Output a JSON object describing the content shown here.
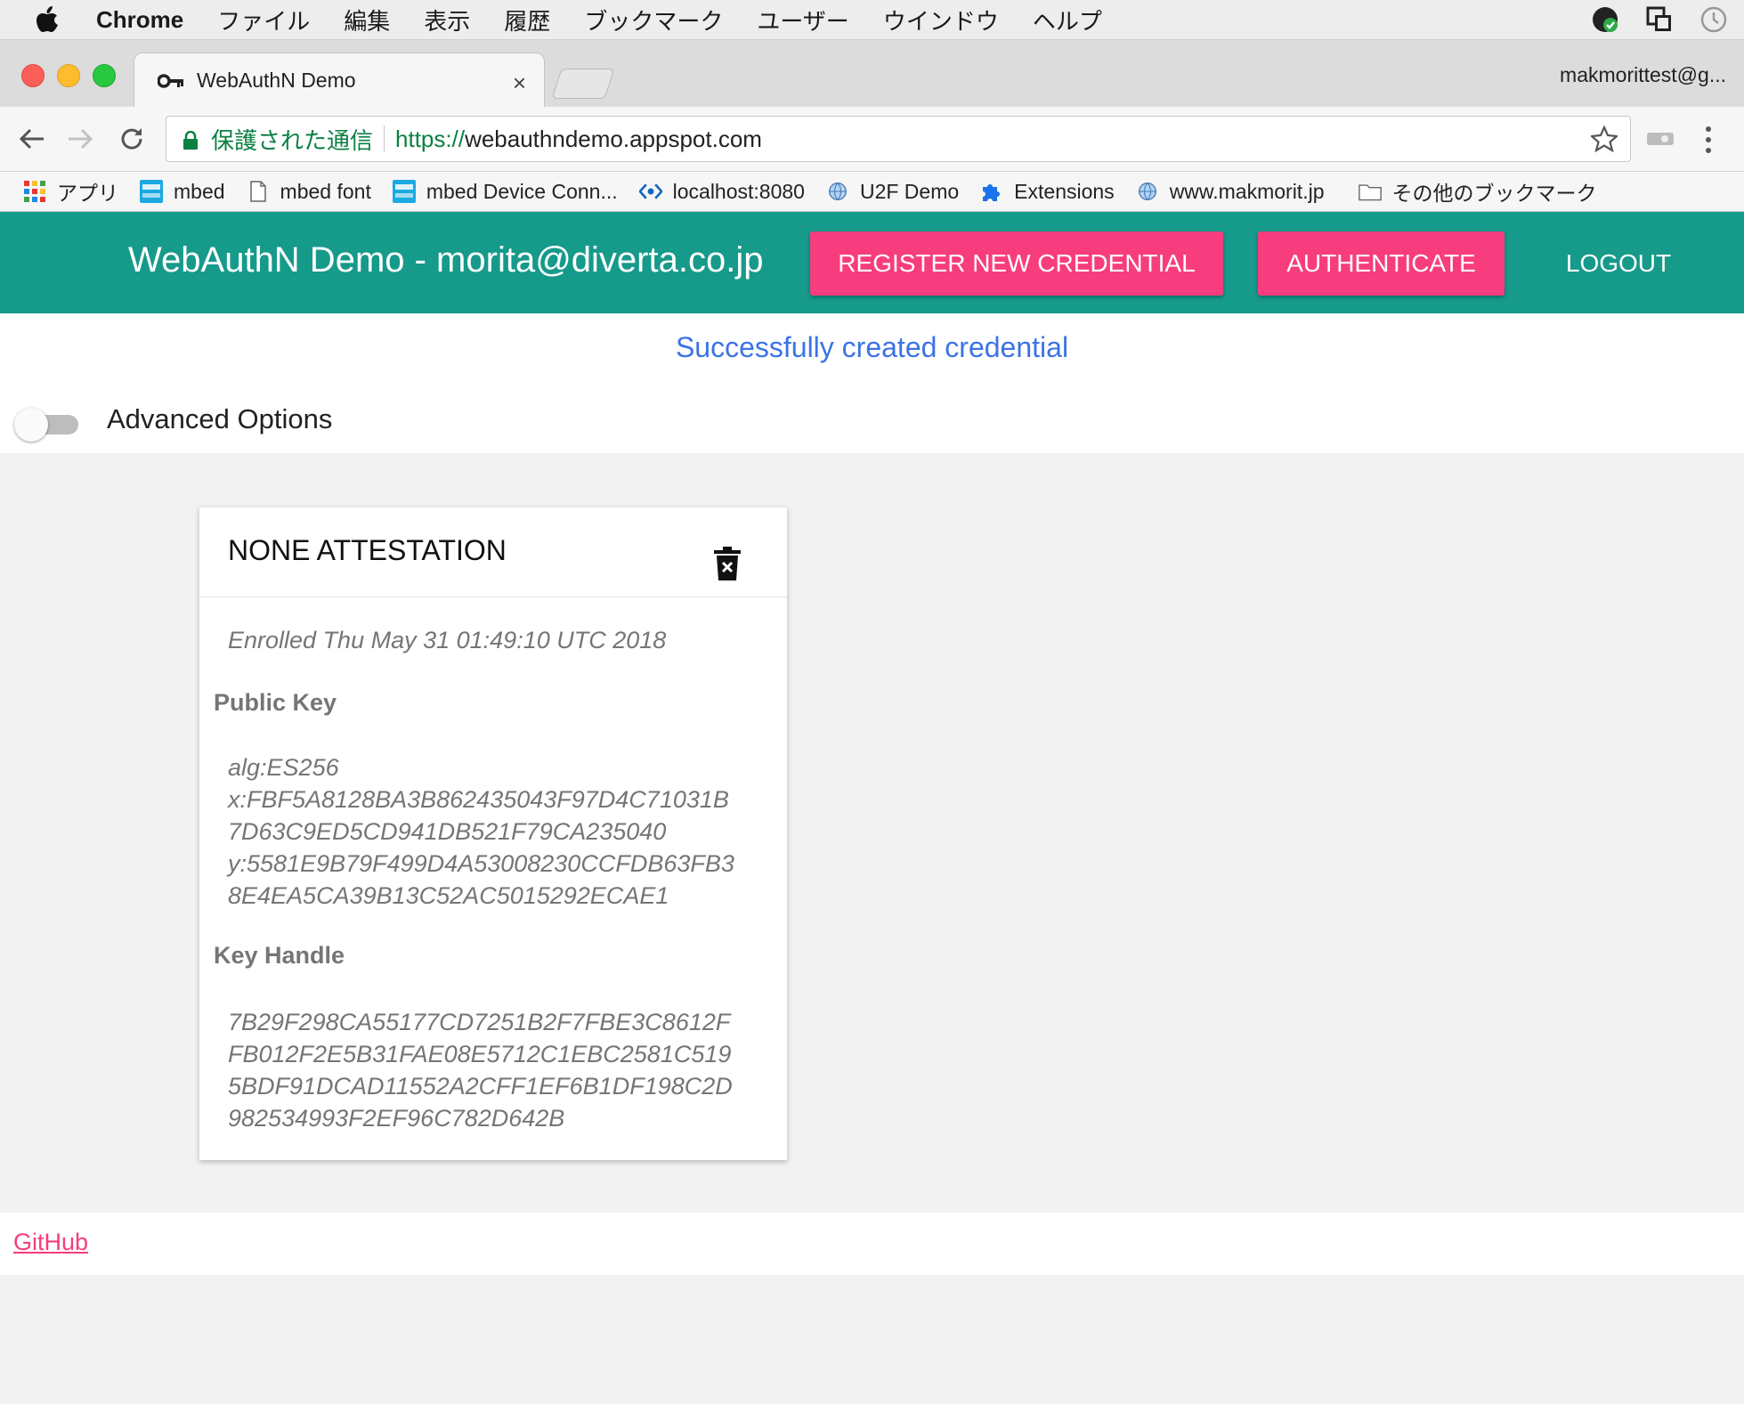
{
  "menubar": {
    "app_name": "Chrome",
    "items": [
      "ファイル",
      "編集",
      "表示",
      "履歴",
      "ブックマーク",
      "ユーザー",
      "ウインドウ",
      "ヘルプ"
    ]
  },
  "tab": {
    "title": "WebAuthN Demo",
    "close": "×"
  },
  "profile": {
    "name": "makmorittest@g..."
  },
  "omnibox": {
    "secure_label": "保護された通信",
    "scheme": "https://",
    "host": "webauthndemo.appspot.com"
  },
  "bookmarks": [
    {
      "label": "アプリ",
      "icon": "apps-grid-icon"
    },
    {
      "label": "mbed",
      "icon": "arm-mbed-icon"
    },
    {
      "label": "mbed font",
      "icon": "page-icon"
    },
    {
      "label": "mbed Device Conn...",
      "icon": "arm-mbed-icon"
    },
    {
      "label": "localhost:8080",
      "icon": "code-icon"
    },
    {
      "label": "U2F Demo",
      "icon": "globe-icon"
    },
    {
      "label": "Extensions",
      "icon": "puzzle-icon"
    },
    {
      "label": "www.makmorit.jp",
      "icon": "globe-icon"
    },
    {
      "label": "その他のブックマーク",
      "icon": "folder-icon"
    }
  ],
  "header": {
    "title": "WebAuthN Demo - morita@diverta.co.jp",
    "register_label": "REGISTER NEW CREDENTIAL",
    "authenticate_label": "AUTHENTICATE",
    "logout_label": "LOGOUT"
  },
  "status": {
    "message": "Successfully created credential"
  },
  "advanced": {
    "label": "Advanced Options",
    "enabled": false
  },
  "credential": {
    "title": "NONE ATTESTATION",
    "enrolled": "Enrolled Thu May 31 01:49:10 UTC 2018",
    "public_key_label": "Public Key",
    "public_key_lines": [
      "alg:ES256",
      "x:FBF5A8128BA3B862435043F97D4C71031B",
      "7D63C9ED5CD941DB521F79CA235040",
      "y:5581E9B79F499D4A53008230CCFDB63FB3",
      "8E4EA5CA39B13C52AC5015292ECAE1"
    ],
    "key_handle_label": "Key Handle",
    "key_handle_lines": [
      "7B29F298CA55177CD7251B2F7FBE3C8612F",
      "FB012F2E5B31FAE08E5712C1EBC2581C519",
      "5BDF91DCAD11552A2CFF1EF6B1DF198C2D",
      "982534993F2EF96C782D642B"
    ]
  },
  "footer": {
    "github_label": "GitHub"
  },
  "colors": {
    "header_bg": "#169a8a",
    "accent": "#f73d7e",
    "status_text": "#3b73e6",
    "secure_green": "#0b8043"
  }
}
